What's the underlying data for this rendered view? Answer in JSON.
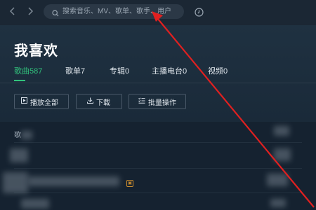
{
  "search": {
    "placeholder": "搜索音乐、MV、歌单、歌手、用户"
  },
  "page": {
    "title": "我喜欢"
  },
  "tabs": [
    {
      "label": "歌曲587",
      "active": true
    },
    {
      "label": "歌单7",
      "active": false
    },
    {
      "label": "专辑0",
      "active": false
    },
    {
      "label": "主播电台0",
      "active": false
    },
    {
      "label": "视频0",
      "active": false
    }
  ],
  "toolbar": {
    "play_all": "播放全部",
    "download": "下载",
    "batch": "批量操作"
  },
  "list": {
    "column_header": "歌",
    "mv_badge": "▣"
  },
  "colors": {
    "accent": "#31c27c",
    "background": "#162331",
    "annotation": "#e02020"
  },
  "icons": {
    "back": "chevron-left-icon",
    "forward": "chevron-right-icon",
    "search": "search-icon",
    "history": "clock-icon",
    "play": "play-icon",
    "download": "download-icon",
    "batch": "checklist-icon"
  }
}
